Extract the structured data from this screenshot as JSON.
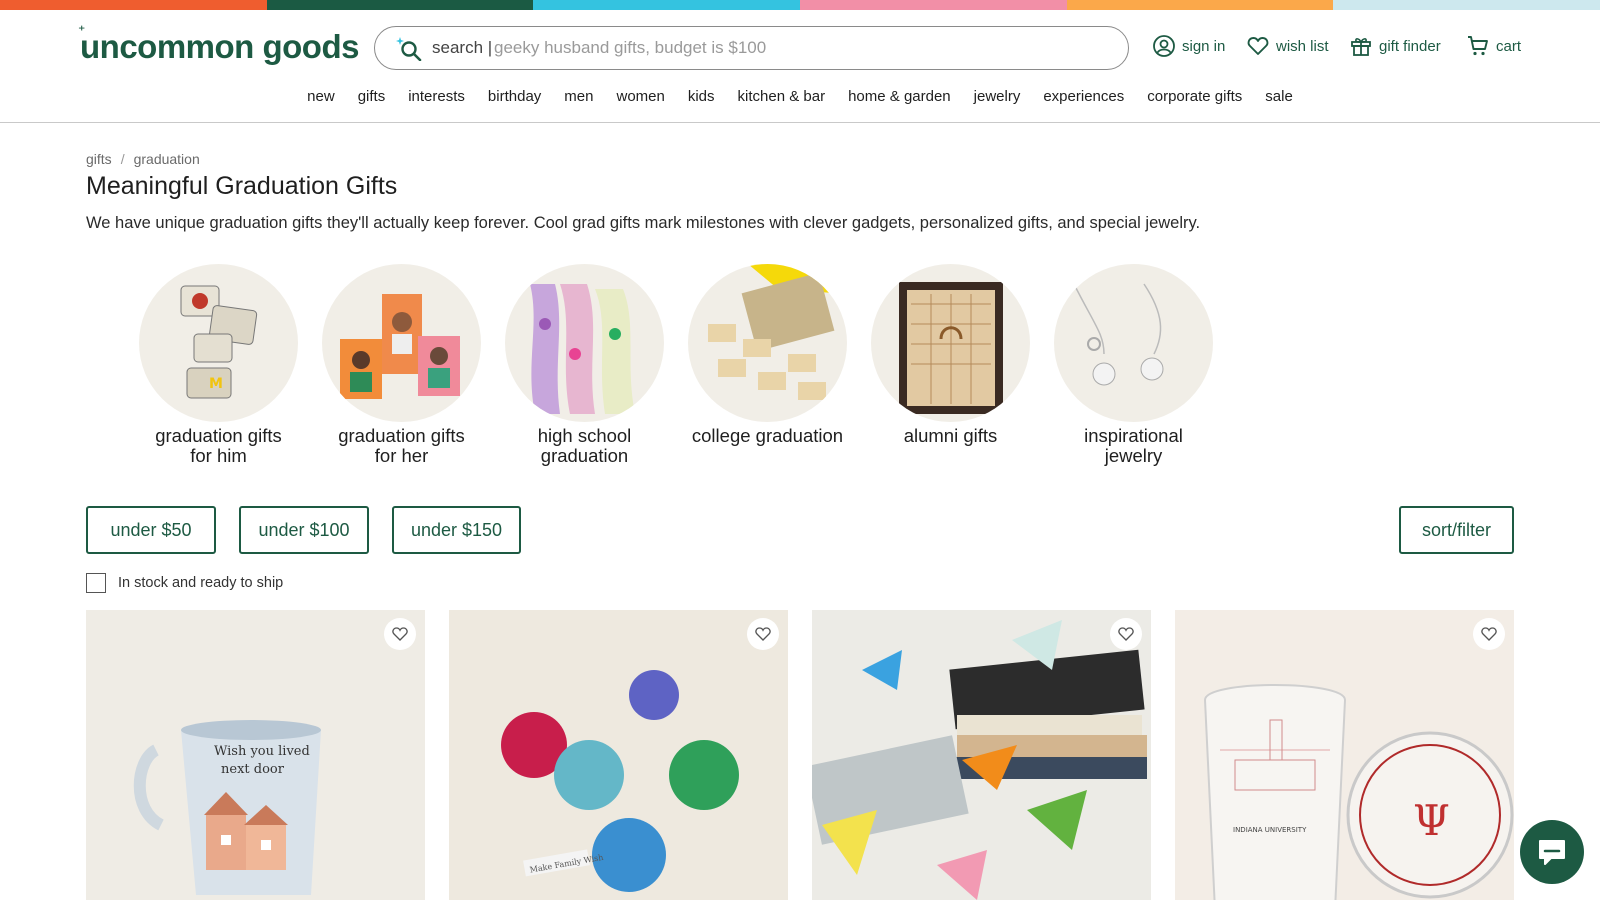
{
  "colors": {
    "brand": "#1d5a43",
    "bar": [
      "#ef5d2f",
      "#1b5a43",
      "#34c3e0",
      "#f28fa7",
      "#fba84a",
      "#cde8ee"
    ]
  },
  "header": {
    "logo_text": "uncommon goods",
    "search_label": "search |",
    "search_placeholder": "geeky husband gifts, budget is $100",
    "sign_in": "sign in",
    "wish_list": "wish list",
    "gift_finder": "gift finder",
    "cart": "cart"
  },
  "nav": [
    "new",
    "gifts",
    "interests",
    "birthday",
    "men",
    "women",
    "kids",
    "kitchen & bar",
    "home & garden",
    "jewelry",
    "experiences",
    "corporate gifts",
    "sale"
  ],
  "breadcrumb": [
    "gifts",
    "graduation"
  ],
  "page": {
    "title": "Meaningful Graduation Gifts",
    "intro": "We have unique graduation gifts they'll actually keep forever. Cool grad gifts mark milestones with clever gadgets, personalized gifts, and special jewelry."
  },
  "categories": [
    {
      "label_line1": "graduation gifts",
      "label_line2": "for him"
    },
    {
      "label_line1": "graduation gifts",
      "label_line2": "for her"
    },
    {
      "label_line1": "high school",
      "label_line2": "graduation"
    },
    {
      "label_line1": "college graduation",
      "label_line2": ""
    },
    {
      "label_line1": "alumni gifts",
      "label_line2": ""
    },
    {
      "label_line1": "inspirational",
      "label_line2": "jewelry"
    }
  ],
  "price_filters": [
    "under $50",
    "under $100",
    "under $150"
  ],
  "sort_filter": "sort/filter",
  "stock_filter": "In stock and ready to ship",
  "products": [
    {
      "mug_text_1": "Wish you lived",
      "mug_text_2": "next door"
    },
    {
      "tag_text": "Make Family Wish"
    },
    {},
    {
      "glass_text": "INDIANA UNIVERSITY"
    }
  ]
}
